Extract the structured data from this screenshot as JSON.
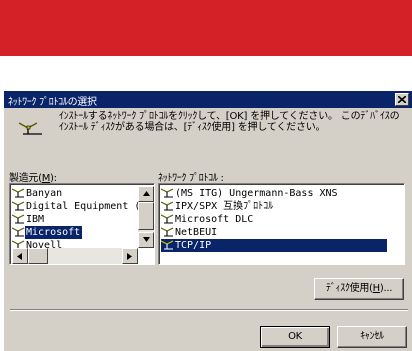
{
  "dialog": {
    "title": "ﾈｯﾄﾜｰｸ ﾌﾟﾛﾄｺﾙの選択",
    "instruction": "ｲﾝｽﾄｰﾙするﾈｯﾄﾜｰｸ ﾌﾟﾛﾄｺﾙをｸﾘｯｸして、[OK] を押してください。 このﾃﾞﾊﾞｲｽのｲﾝｽﾄｰﾙ ﾃﾞｨｽｸがある場合は、[ﾃﾞｨｽｸ使用] を押してください。",
    "close_glyph": "×"
  },
  "manufacturers": {
    "label_prefix": "製造元(",
    "label_key": "M",
    "label_suffix": "):",
    "items": [
      "Banyan",
      "Digital Equipment (",
      "IBM",
      "Microsoft",
      "Novell"
    ],
    "selected": "Microsoft"
  },
  "protocols": {
    "label": "ﾈｯﾄﾜｰｸ ﾌﾟﾛﾄｺﾙ :",
    "items": [
      "(MS ITG) Ungermann-Bass XNS",
      "IPX/SPX 互換ﾌﾟﾛﾄｺﾙ",
      "Microsoft DLC",
      "NetBEUI",
      "TCP/IP"
    ],
    "selected": "TCP/IP"
  },
  "buttons": {
    "disk_prefix": "ﾃﾞｨｽｸ使用(",
    "disk_key": "H",
    "disk_suffix": ")...",
    "ok": "OK",
    "cancel": "ｷｬﾝｾﾙ"
  },
  "colors": {
    "banner": "#d42027",
    "titlebar": "#0a246a",
    "selection": "#0a246a",
    "dialog_face": "#d4d0c8"
  },
  "icons": [
    "network-protocol-icon",
    "close-icon",
    "scroll-arrow-icon"
  ]
}
